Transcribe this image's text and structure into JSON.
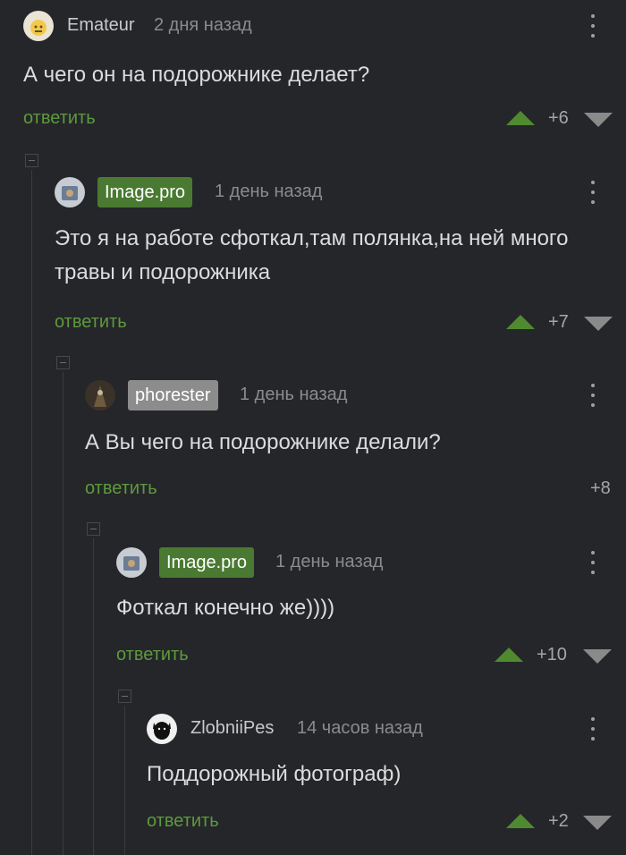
{
  "comments": [
    {
      "author": "Emateur",
      "time": "2 дня назад",
      "text": "А чего он на подорожнике делает?",
      "reply": "ответить",
      "score": "+6"
    },
    {
      "author": "Image.pro",
      "time": "1 день назад",
      "text": "Это я на работе сфоткал,там полянка,на ней много травы и подорожника",
      "reply": "ответить",
      "score": "+7"
    },
    {
      "author": "phorester",
      "time": "1 день назад",
      "text": "А Вы чего на подорожнике делали?",
      "reply": "ответить",
      "score": "+8"
    },
    {
      "author": "Image.pro",
      "time": "1 день назад",
      "text": "Фоткал конечно же))))",
      "reply": "ответить",
      "score": "+10"
    },
    {
      "author": "ZlobniiPes",
      "time": "14 часов назад",
      "text": "Поддорожный фотограф)",
      "reply": "ответить",
      "score": "+2"
    }
  ],
  "colors": {
    "background": "#25262a",
    "reply_link": "#5d9a3c",
    "upvote": "#4f8a30",
    "author_badge": "#4a7a32",
    "op_badge": "#8c8c8c"
  },
  "icons": [
    "avatar",
    "more-vertical-icon",
    "upvote-arrow-icon",
    "downvote-arrow-icon",
    "collapse-thread-icon"
  ]
}
